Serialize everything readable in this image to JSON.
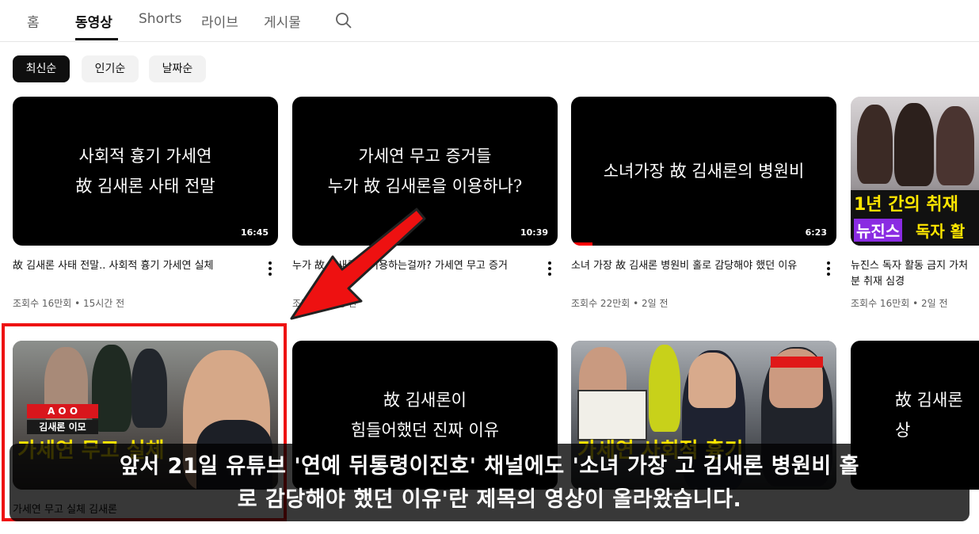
{
  "tabs": [
    {
      "label": "홈"
    },
    {
      "label": "동영상"
    },
    {
      "label": "Shorts"
    },
    {
      "label": "라이브"
    },
    {
      "label": "게시물"
    }
  ],
  "active_tab": "동영상",
  "chips": [
    {
      "label": "최신순"
    },
    {
      "label": "인기순"
    },
    {
      "label": "날짜순"
    }
  ],
  "videos": [
    {
      "thumb_text": "사회적 흉기 가세연\n故 김새론 사태 전말",
      "duration": "16:45",
      "title": "故 김새론 사태 전말.. 사회적 흉기 가세연 실체",
      "meta": "조회수 16만회 • 15시간 전"
    },
    {
      "thumb_text": "가세연 무고 증거들\n누가 故 김새론을 이용하나?",
      "duration": "10:39",
      "title": "누가 故 김새론을 이용하는걸까? 가세연 무고 증거",
      "meta": "조회수 • 1일 전"
    },
    {
      "thumb_text": "소녀가장 故 김새론의 병원비",
      "duration": "6:23",
      "title": "소녀 가장 故 김새론 병원비 홀로 감당해야 했던 이유",
      "meta": "조회수 22만회 • 2일 전",
      "progress": 0.08
    },
    {
      "thumb_line1": "1년 간의 취재",
      "thumb_line2_a": "뉴진스",
      "thumb_line2_b": "독자 활",
      "title": "뉴진스 독자 활동 금지 가처분 취재 심경",
      "meta": "조회수 16만회 • 2일 전"
    },
    {
      "thumb_tag": "A O O",
      "thumb_sub": "김새론 이모",
      "thumb_bottom": "가세연 무고 실체",
      "title": "가세연 무고 실체 김새론",
      "meta": ""
    },
    {
      "thumb_text": "故 김새론이\n힘들어했던 진짜 이유",
      "title": "",
      "meta": ""
    },
    {
      "thumb_bottom": "가세연 사회적 흉기",
      "title": "",
      "meta": ""
    },
    {
      "thumb_text": "故 김새론 상",
      "title": "",
      "meta": ""
    }
  ],
  "caption": "앞서 21일 유튜브 '연예 뒤통령이진호' 채널에도 '소녀 가장 고 김새론 병원비 홀\n로 감당해야 했던 이유'란 제목의 영상이 올라왔습니다.",
  "colors": {
    "highlight": "#ee1111",
    "accent": "#ff0000",
    "banner_yellow": "#ffe600",
    "banner_purple": "#8a2be2"
  }
}
